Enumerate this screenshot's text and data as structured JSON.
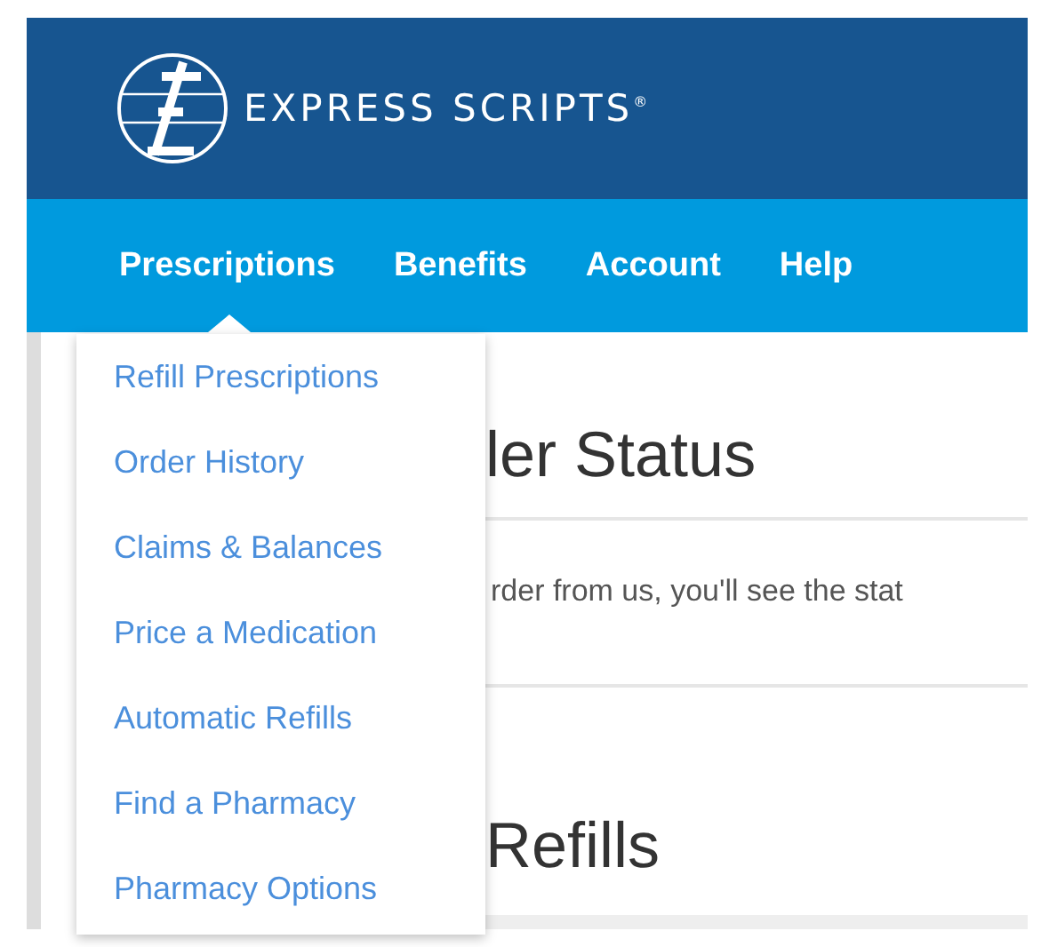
{
  "header": {
    "brand": "EXPRESS SCRIPTS$^{®}$"
  },
  "nav": [
    {
      "label": "Prescriptions",
      "selected": true
    },
    {
      "label": "Benefits",
      "selected": false
    },
    {
      "label": "Account",
      "selected": false
    },
    {
      "label": "Help",
      "selected": false
    }
  ],
  "dropdown": {
    "items": [
      "Refill Prescriptions",
      "Order History",
      "Claims & Balances",
      "Price a Medication",
      "Automatic Refills",
      "Find a Pharmacy",
      "Pharmacy Options"
    ]
  },
  "content": {
    "sections": [
      {
        "heading": "ler Status",
        "text": "rder from us, you'll see the stat"
      },
      {
        "heading": "Refills"
      }
    ]
  }
}
